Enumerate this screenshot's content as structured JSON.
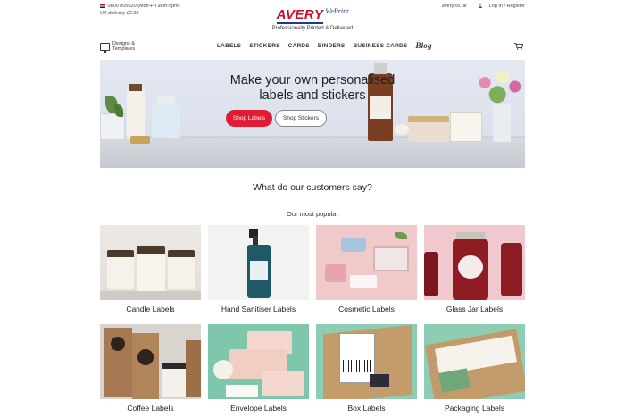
{
  "topbar": {
    "phone": "0800 805020",
    "phone_hours": "(Mon-Fri 9am-5pm)",
    "delivery": "UK delivery £2.99",
    "site_link": "avery.co.uk",
    "account": "Log In / Register"
  },
  "logo": {
    "brand": "AVERY",
    "sub": "WePrint",
    "tagline": "Professionally Printed & Delivered"
  },
  "nav": {
    "designs_line1": "Designs &",
    "designs_line2": "Templates",
    "items": [
      "LABELS",
      "STICKERS",
      "CARDS",
      "BINDERS",
      "BUSINESS CARDS"
    ],
    "blog": "Blog"
  },
  "hero": {
    "title_line1": "Make your own personalised",
    "title_line2": "labels and stickers",
    "shop_labels": "Shop Labels",
    "shop_stickers": "Shop Stickers"
  },
  "sections": {
    "customers_heading": "What do our customers say?",
    "popular_heading": "Our most popular"
  },
  "products": [
    {
      "label": "Candle Labels"
    },
    {
      "label": "Hand Sanitiser Labels"
    },
    {
      "label": "Cosmetic Labels"
    },
    {
      "label": "Glass Jar Labels"
    },
    {
      "label": "Coffee Labels"
    },
    {
      "label": "Envelope Labels"
    },
    {
      "label": "Box Labels"
    },
    {
      "label": "Packaging Labels"
    }
  ],
  "colors": {
    "brand_red": "#e11b34",
    "brand_blue": "#1e3a8a",
    "hero_bg": "#e3e8f1"
  }
}
